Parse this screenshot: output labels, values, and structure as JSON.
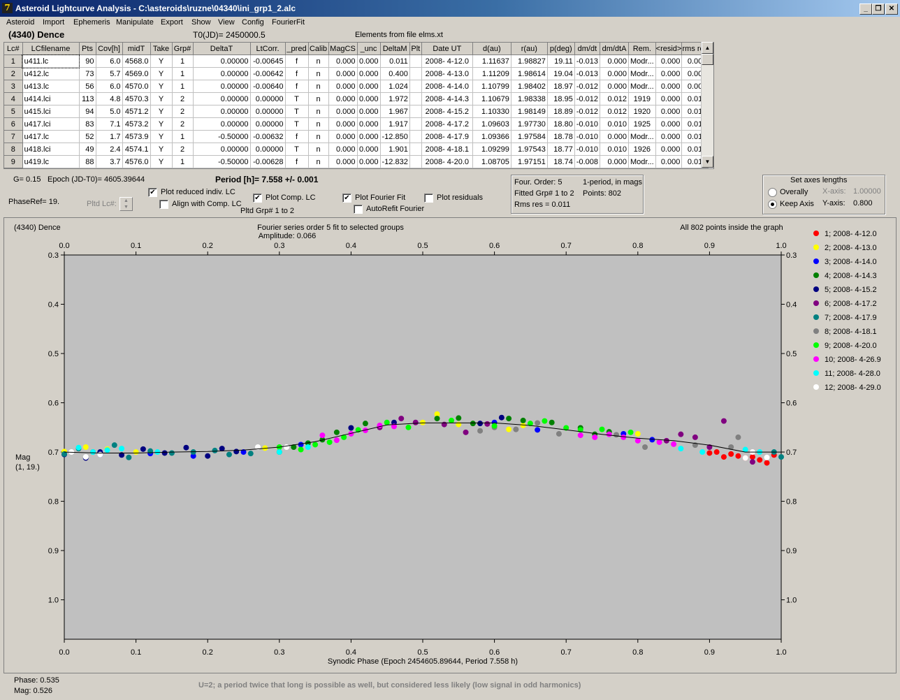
{
  "window": {
    "title": "Asteroid Lightcurve Analysis - C:\\asteroids\\ruzne\\04340\\ini_grp1_2.alc",
    "icon_text": "7"
  },
  "menu": [
    "Asteroid",
    "Import",
    "Ephemeris",
    "Manipulate",
    "Export",
    "Show",
    "View",
    "Config",
    "FourierFit"
  ],
  "header": {
    "asteroid": "(4340) Dence",
    "t0": "T0(JD)= 2450000.5",
    "elements": "Elements from file elms.xt"
  },
  "grid": {
    "columns": [
      "Lc#",
      "LCfilename",
      "Pts",
      "Cov[h]",
      "midT",
      "Take",
      "Grp#",
      "DeltaT",
      "LtCorr.",
      "_pred",
      "Calib",
      "MagCS",
      "_unc",
      "DeltaM",
      "Plt",
      "Date UT",
      "d(au)",
      "r(au)",
      "p(deg)",
      "dm/dt",
      "dm/dtA",
      "Rem.",
      "<resid>",
      "rms res"
    ],
    "rows": [
      [
        "1",
        "u411.lc",
        "90",
        "6.0",
        "4568.0",
        "Y",
        "1",
        "0.00000",
        "-0.00645",
        "f",
        "n",
        "0.000",
        "0.000",
        "0.011",
        "",
        "2008- 4-12.0",
        "1.11637",
        "1.98827",
        "19.11",
        "-0.013",
        "0.000",
        "Modr...",
        "0.000",
        "0.009"
      ],
      [
        "2",
        "u412.lc",
        "73",
        "5.7",
        "4569.0",
        "Y",
        "1",
        "0.00000",
        "-0.00642",
        "f",
        "n",
        "0.000",
        "0.000",
        "0.400",
        "",
        "2008- 4-13.0",
        "1.11209",
        "1.98614",
        "19.04",
        "-0.013",
        "0.000",
        "Modr...",
        "0.000",
        "0.009"
      ],
      [
        "3",
        "u413.lc",
        "56",
        "6.0",
        "4570.0",
        "Y",
        "1",
        "0.00000",
        "-0.00640",
        "f",
        "n",
        "0.000",
        "0.000",
        "1.024",
        "",
        "2008- 4-14.0",
        "1.10799",
        "1.98402",
        "18.97",
        "-0.012",
        "0.000",
        "Modr...",
        "0.000",
        "0.008"
      ],
      [
        "4",
        "u414.lci",
        "113",
        "4.8",
        "4570.3",
        "Y",
        "2",
        "0.00000",
        "0.00000",
        "T",
        "n",
        "0.000",
        "0.000",
        "1.972",
        "",
        "2008- 4-14.3",
        "1.10679",
        "1.98338",
        "18.95",
        "-0.012",
        "0.012",
        "1919",
        "0.000",
        "0.010"
      ],
      [
        "5",
        "u415.lci",
        "94",
        "5.0",
        "4571.2",
        "Y",
        "2",
        "0.00000",
        "0.00000",
        "T",
        "n",
        "0.000",
        "0.000",
        "1.967",
        "",
        "2008- 4-15.2",
        "1.10330",
        "1.98149",
        "18.89",
        "-0.012",
        "0.012",
        "1920",
        "0.000",
        "0.010"
      ],
      [
        "6",
        "u417.lci",
        "83",
        "7.1",
        "4573.2",
        "Y",
        "2",
        "0.00000",
        "0.00000",
        "T",
        "n",
        "0.000",
        "0.000",
        "1.917",
        "",
        "2008- 4-17.2",
        "1.09603",
        "1.97730",
        "18.80",
        "-0.010",
        "0.010",
        "1925",
        "0.000",
        "0.014"
      ],
      [
        "7",
        "u417.lc",
        "52",
        "1.7",
        "4573.9",
        "Y",
        "1",
        "-0.50000",
        "-0.00632",
        "f",
        "n",
        "0.000",
        "0.000",
        "-12.850",
        "",
        "2008- 4-17.9",
        "1.09366",
        "1.97584",
        "18.78",
        "-0.010",
        "0.000",
        "Modr...",
        "0.000",
        "0.013"
      ],
      [
        "8",
        "u418.lci",
        "49",
        "2.4",
        "4574.1",
        "Y",
        "2",
        "0.00000",
        "0.00000",
        "T",
        "n",
        "0.000",
        "0.000",
        "1.901",
        "",
        "2008- 4-18.1",
        "1.09299",
        "1.97543",
        "18.77",
        "-0.010",
        "0.010",
        "1926",
        "0.000",
        "0.013"
      ],
      [
        "9",
        "u419.lc",
        "88",
        "3.7",
        "4576.0",
        "Y",
        "1",
        "-0.50000",
        "-0.00628",
        "f",
        "n",
        "0.000",
        "0.000",
        "-12.832",
        "",
        "2008- 4-20.0",
        "1.08705",
        "1.97151",
        "18.74",
        "-0.008",
        "0.000",
        "Modr...",
        "0.000",
        "0.010"
      ]
    ]
  },
  "params": {
    "g": "G= 0.15",
    "epoch": "Epoch (JD-T0)= 4605.39644",
    "period": "Period [h]= 7.558 +/- 0.001",
    "phaseref": "PhaseRef= 19.",
    "pltd_lc": "Pltd Lc#:",
    "pltd_grp": "Pltd Grp#  1   to   2"
  },
  "checkboxes": {
    "plot_reduced": {
      "label": "Plot reduced indiv. LC",
      "checked": true
    },
    "align_comp": {
      "label": "Align with Comp. LC",
      "checked": false
    },
    "plot_comp": {
      "label": "Plot Comp. LC",
      "checked": true
    },
    "plot_fourier": {
      "label": "Plot Fourier Fit",
      "checked": true
    },
    "plot_residuals": {
      "label": "Plot residuals",
      "checked": false
    },
    "autorefit": {
      "label": "AutoRefit Fourier",
      "checked": false
    }
  },
  "fitinfo": {
    "order": "Four. Order:  5",
    "fitted": "Fitted Grp# 1 to 2",
    "rms": "Rms res      = 0.011",
    "mode": "1-period, in mags",
    "points": "Points: 802"
  },
  "axes_box": {
    "title": "Set axes lengths",
    "overally": "Overally",
    "keep": "Keep Axis",
    "xaxis_label": "X-axis:",
    "xaxis_val": "1.00000",
    "yaxis_label": "Y-axis:",
    "yaxis_val": "0.800",
    "selected": "keep"
  },
  "plot": {
    "name": "(4340) Dence",
    "subtitle": "Fourier series order 5 fit to selected groups",
    "amplitude": "Amplitude: 0.066",
    "inside": "All 802 points inside the graph",
    "ylabel": "Mag",
    "ylabel2": "(1, 19.)"
  },
  "status": {
    "phase": "Phase:  0.535",
    "mag": "Mag:   0.526",
    "note": "U=2; a period twice that long is possible as well, but considered less likely (low signal in odd harmonics)"
  },
  "chart_data": {
    "type": "scatter",
    "xlabel": "Synodic Phase (Epoch 2454605.89644, Period 7.558 h)",
    "xlim": [
      0.0,
      1.0
    ],
    "ylim": [
      0.3,
      1.08
    ],
    "y_inverted": true,
    "xticks": [
      "0.0",
      "0.1",
      "0.2",
      "0.3",
      "0.4",
      "0.5",
      "0.6",
      "0.7",
      "0.8",
      "0.9",
      "1.0"
    ],
    "yticks": [
      "0.3",
      "0.4",
      "0.5",
      "0.6",
      "0.7",
      "0.8",
      "0.9",
      "1.0"
    ],
    "grid": false,
    "legend_position": "right",
    "fourier_fit": {
      "phase": [
        0.0,
        0.05,
        0.1,
        0.15,
        0.2,
        0.25,
        0.3,
        0.35,
        0.4,
        0.45,
        0.5,
        0.55,
        0.6,
        0.65,
        0.7,
        0.75,
        0.8,
        0.85,
        0.9,
        0.95,
        1.0
      ],
      "mag": [
        0.7,
        0.702,
        0.702,
        0.7,
        0.699,
        0.696,
        0.69,
        0.679,
        0.662,
        0.645,
        0.641,
        0.641,
        0.641,
        0.646,
        0.655,
        0.664,
        0.672,
        0.677,
        0.686,
        0.7,
        0.7
      ]
    },
    "series": [
      {
        "name": "1; 2008- 4-12.0",
        "color": "#ff0000",
        "phase": [
          0.9,
          0.92,
          0.94,
          0.96,
          0.98,
          0.95,
          0.93,
          0.91,
          0.99,
          0.97
        ],
        "mag": [
          0.702,
          0.71,
          0.708,
          0.71,
          0.722,
          0.712,
          0.704,
          0.7,
          0.706,
          0.716
        ]
      },
      {
        "name": "2; 2008- 4-13.0",
        "color": "#ffff00",
        "phase": [
          0.0,
          0.03,
          0.06,
          0.1,
          0.28,
          0.5,
          0.52,
          0.55,
          0.62,
          0.64,
          0.8
        ],
        "mag": [
          0.699,
          0.69,
          0.694,
          0.7,
          0.692,
          0.64,
          0.623,
          0.644,
          0.654,
          0.646,
          0.663
        ]
      },
      {
        "name": "3; 2008- 4-14.0",
        "color": "#0000ff",
        "phase": [
          0.05,
          0.12,
          0.18,
          0.25,
          0.33,
          0.6,
          0.66,
          0.78,
          0.82
        ],
        "mag": [
          0.705,
          0.703,
          0.708,
          0.7,
          0.685,
          0.64,
          0.655,
          0.663,
          0.675
        ]
      },
      {
        "name": "4; 2008- 4-14.3",
        "color": "#008000",
        "phase": [
          0.3,
          0.32,
          0.34,
          0.36,
          0.38,
          0.42,
          0.52,
          0.55,
          0.57,
          0.62,
          0.64,
          0.68,
          0.72,
          0.74,
          0.76
        ],
        "mag": [
          0.7,
          0.69,
          0.682,
          0.675,
          0.66,
          0.642,
          0.632,
          0.631,
          0.642,
          0.632,
          0.636,
          0.64,
          0.651,
          0.664,
          0.659
        ]
      },
      {
        "name": "5; 2008- 4-15.2",
        "color": "#000080",
        "phase": [
          0.0,
          0.03,
          0.05,
          0.08,
          0.11,
          0.14,
          0.17,
          0.2,
          0.22,
          0.24,
          0.4,
          0.46,
          0.58,
          0.61
        ],
        "mag": [
          0.705,
          0.712,
          0.7,
          0.706,
          0.694,
          0.702,
          0.691,
          0.708,
          0.693,
          0.699,
          0.651,
          0.64,
          0.642,
          0.63
        ]
      },
      {
        "name": "6; 2008- 4-17.2",
        "color": "#800080",
        "phase": [
          0.44,
          0.47,
          0.49,
          0.53,
          0.56,
          0.59,
          0.84,
          0.86,
          0.88,
          0.9,
          0.92,
          0.96
        ],
        "mag": [
          0.65,
          0.632,
          0.64,
          0.644,
          0.66,
          0.643,
          0.677,
          0.664,
          0.67,
          0.69,
          0.637,
          0.72
        ]
      },
      {
        "name": "7; 2008- 4-17.9",
        "color": "#008080",
        "phase": [
          0.0,
          0.02,
          0.04,
          0.07,
          0.09,
          0.12,
          0.15,
          0.18,
          0.21,
          0.23,
          0.26,
          0.99,
          1.0
        ],
        "mag": [
          0.704,
          0.693,
          0.7,
          0.686,
          0.711,
          0.698,
          0.702,
          0.7,
          0.697,
          0.705,
          0.703,
          0.7,
          0.71
        ]
      },
      {
        "name": "8; 2008- 4-18.1",
        "color": "#808080",
        "phase": [
          0.58,
          0.6,
          0.63,
          0.66,
          0.69,
          0.77,
          0.81,
          0.88,
          0.93,
          0.94
        ],
        "mag": [
          0.657,
          0.65,
          0.654,
          0.641,
          0.663,
          0.665,
          0.69,
          0.686,
          0.69,
          0.67
        ]
      },
      {
        "name": "9; 2008- 4-20.0",
        "color": "#00ff00",
        "phase": [
          0.3,
          0.33,
          0.35,
          0.37,
          0.39,
          0.41,
          0.45,
          0.48,
          0.54,
          0.6,
          0.65,
          0.67,
          0.7,
          0.72,
          0.75,
          0.79
        ],
        "mag": [
          0.69,
          0.695,
          0.685,
          0.68,
          0.67,
          0.655,
          0.64,
          0.65,
          0.636,
          0.647,
          0.642,
          0.637,
          0.651,
          0.655,
          0.654,
          0.66
        ]
      },
      {
        "name": "10; 2008- 4-26.9",
        "color": "#ff00ff",
        "phase": [
          0.36,
          0.38,
          0.4,
          0.42,
          0.44,
          0.46,
          0.72,
          0.74,
          0.76,
          0.78,
          0.8,
          0.83,
          0.85
        ],
        "mag": [
          0.666,
          0.676,
          0.663,
          0.656,
          0.646,
          0.648,
          0.666,
          0.67,
          0.664,
          0.67,
          0.677,
          0.68,
          0.684
        ]
      },
      {
        "name": "11; 2008- 4-28.0",
        "color": "#00ffff",
        "phase": [
          0.02,
          0.04,
          0.06,
          0.08,
          0.13,
          0.3,
          0.34,
          0.86,
          0.89,
          0.95,
          0.97
        ],
        "mag": [
          0.691,
          0.7,
          0.696,
          0.693,
          0.7,
          0.7,
          0.69,
          0.693,
          0.7,
          0.695,
          0.7
        ]
      },
      {
        "name": "12; 2008- 4-29.0",
        "color": "#ffffff",
        "phase": [
          0.01,
          0.03,
          0.05,
          0.27,
          0.31,
          0.95,
          0.96,
          0.98
        ],
        "mag": [
          0.7,
          0.71,
          0.705,
          0.69,
          0.69,
          0.712,
          0.7,
          0.711
        ]
      }
    ]
  }
}
